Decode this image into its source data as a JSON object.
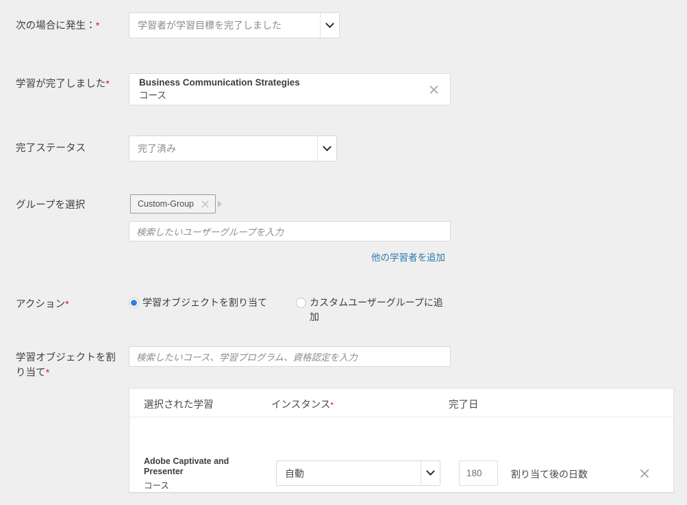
{
  "theme": {
    "background": "#efefef",
    "panel_background": "#ffffff",
    "border": "#d8d8d8",
    "text": "#3d3d3d",
    "muted_text": "#8a8a8a",
    "required_asterisk": "#c8102e",
    "link": "#2a7ab0",
    "radio_selected": "#2f80d8"
  },
  "form": {
    "trigger": {
      "label": "次の場合に発生：",
      "required": "*",
      "select_value": "学習者が学習目標を完了しました",
      "icon": "chevron-down-icon"
    },
    "learning_completed": {
      "label": "学習が完了しました",
      "required": "*",
      "item_title": "Business Communication Strategies",
      "item_subtitle": "コース",
      "remove_icon": "close-icon"
    },
    "completion_status": {
      "label": "完了ステータス",
      "select_value": "完了済み",
      "icon": "chevron-down-icon"
    },
    "group_select": {
      "label": "グループを選択",
      "chip_label": "Custom-Group",
      "chip_remove_icon": "close-icon",
      "overflow_icon": "caret-right-icon",
      "search_placeholder": "検索したいユーザーグループを入力",
      "add_link": "他の学習者を追加"
    },
    "action": {
      "label": "アクション",
      "required": "*",
      "options": [
        {
          "label": "学習オブジェクトを割り当て",
          "selected": true
        },
        {
          "label": "カスタムユーザーグループに追加",
          "selected": false
        }
      ]
    },
    "assign_learning_object": {
      "label": "学習オブジェクトを割り当て",
      "required": "*",
      "search_placeholder": "検索したいコース、学習プログラム、資格認定を入力"
    }
  },
  "table": {
    "columns": [
      {
        "header": "選択された学習",
        "required": ""
      },
      {
        "header": "インスタンス",
        "required": "*"
      },
      {
        "header": "完了日",
        "required": ""
      }
    ],
    "rows": [
      {
        "learning_title": "Adobe Captivate and Presenter",
        "learning_subtitle": "コース",
        "instance_value": "自動",
        "instance_icon": "chevron-down-icon",
        "days_value": "180",
        "days_label": "割り当て後の日数",
        "remove_icon": "close-icon"
      }
    ]
  }
}
